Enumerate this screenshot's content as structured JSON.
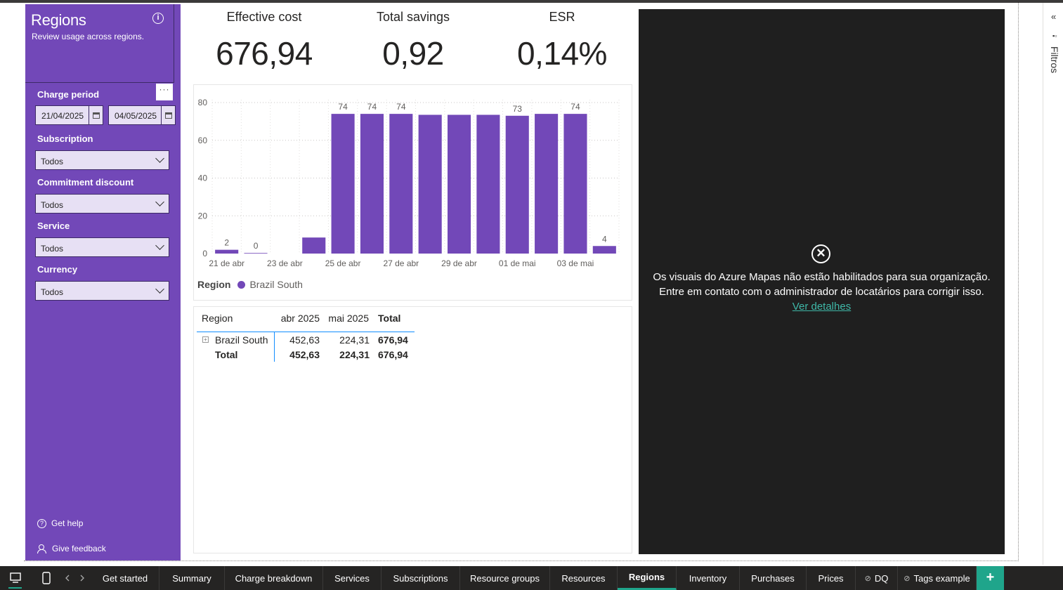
{
  "sidebar": {
    "title": "Regions",
    "subtitle": "Review usage across regions.",
    "charge_period_label": "Charge period",
    "more_label": "···",
    "start_date": "21/04/2025",
    "end_date": "04/05/2025",
    "filters": [
      {
        "label": "Subscription",
        "value": "Todos"
      },
      {
        "label": "Commitment discount",
        "value": "Todos"
      },
      {
        "label": "Service",
        "value": "Todos"
      },
      {
        "label": "Currency",
        "value": "Todos"
      }
    ],
    "help_label": "Get help",
    "feedback_label": "Give feedback"
  },
  "kpis": [
    {
      "label": "Effective cost",
      "value": "676,94"
    },
    {
      "label": "Total savings",
      "value": "0,92"
    },
    {
      "label": "ESR",
      "value": "0,14%"
    }
  ],
  "chart_data": {
    "type": "bar",
    "categories": [
      "21 de abr",
      "22 de abr",
      "23 de abr",
      "24 de abr",
      "25 de abr",
      "26 de abr",
      "27 de abr",
      "28 de abr",
      "29 de abr",
      "30 de abr",
      "01 de mai",
      "02 de mai",
      "03 de mai",
      "04 de mai"
    ],
    "x_tick_labels": [
      "21 de abr",
      "23 de abr",
      "25 de abr",
      "27 de abr",
      "29 de abr",
      "01 de mai",
      "03 de mai"
    ],
    "series": [
      {
        "name": "Brazil South",
        "values": [
          2,
          0.3,
          0,
          8.5,
          74,
          74,
          74,
          73.5,
          73.5,
          73.5,
          73,
          74,
          74,
          4
        ]
      }
    ],
    "data_labels": [
      "2",
      "0",
      "",
      "",
      "74",
      "74",
      "74",
      "",
      "",
      "",
      "73",
      "",
      "74",
      "4"
    ],
    "ylim": [
      0,
      80
    ],
    "y_ticks": [
      0,
      20,
      40,
      60,
      80
    ],
    "grid": true,
    "legend_title": "Region",
    "color": "#7248b8"
  },
  "matrix": {
    "headers": [
      "Region",
      "abr 2025",
      "mai 2025",
      "Total"
    ],
    "rows": [
      {
        "label": "Brazil South",
        "values": [
          "452,63",
          "224,31",
          "676,94"
        ]
      },
      {
        "label": "Total",
        "values": [
          "452,63",
          "224,31",
          "676,94"
        ]
      }
    ],
    "expand_symbol": "+"
  },
  "map": {
    "close_symbol": "✕",
    "message": "Os visuais do Azure Mapas não estão habilitados para sua organização. Entre em contato com o administrador de locatários para corrigir isso.",
    "link": "Ver detalhes"
  },
  "filter_pane": {
    "label": "Filtros",
    "collapse_symbol": "«"
  },
  "tabs": [
    {
      "label": "Get started",
      "hidden": false
    },
    {
      "label": "Summary",
      "hidden": false
    },
    {
      "label": "Charge breakdown",
      "hidden": false
    },
    {
      "label": "Services",
      "hidden": false
    },
    {
      "label": "Subscriptions",
      "hidden": false
    },
    {
      "label": "Resource groups",
      "hidden": false
    },
    {
      "label": "Resources",
      "hidden": false
    },
    {
      "label": "Regions",
      "hidden": false,
      "active": true
    },
    {
      "label": "Inventory",
      "hidden": false
    },
    {
      "label": "Purchases",
      "hidden": false
    },
    {
      "label": "Prices",
      "hidden": false
    },
    {
      "label": "DQ",
      "hidden": true
    },
    {
      "label": "Tags example",
      "hidden": true
    }
  ],
  "add_tab_symbol": "+",
  "colors": {
    "accent": "#7248b8",
    "tab_accent": "#1fa58b",
    "map_bg": "#1f1f1f",
    "link": "#3fb8a8"
  }
}
